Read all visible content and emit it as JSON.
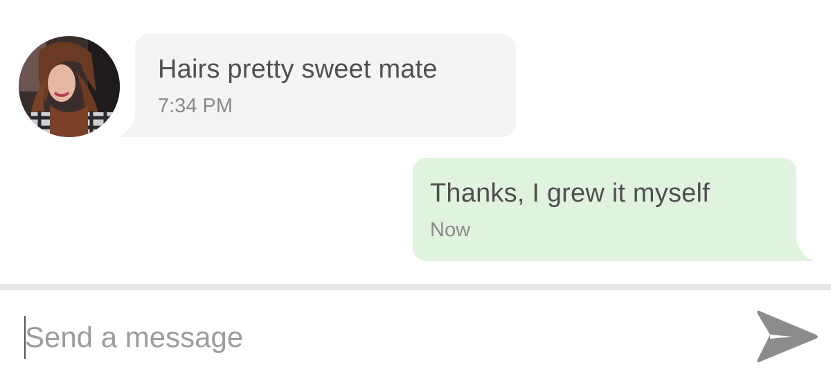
{
  "messages": [
    {
      "direction": "incoming",
      "text": "Hairs pretty sweet mate",
      "time": "7:34 PM",
      "bubble_color": "#f4f4f4"
    },
    {
      "direction": "outgoing",
      "text": "Thanks, I grew it myself",
      "time": "Now",
      "bubble_color": "#e0f3de"
    }
  ],
  "composer": {
    "placeholder": "Send a message",
    "value": "",
    "send_icon": "send-arrow-icon"
  },
  "colors": {
    "text": "#4f4f4f",
    "timestamp": "#8a8a8a",
    "send_icon": "#8c8c8c",
    "divider": "#e6e6e6"
  }
}
